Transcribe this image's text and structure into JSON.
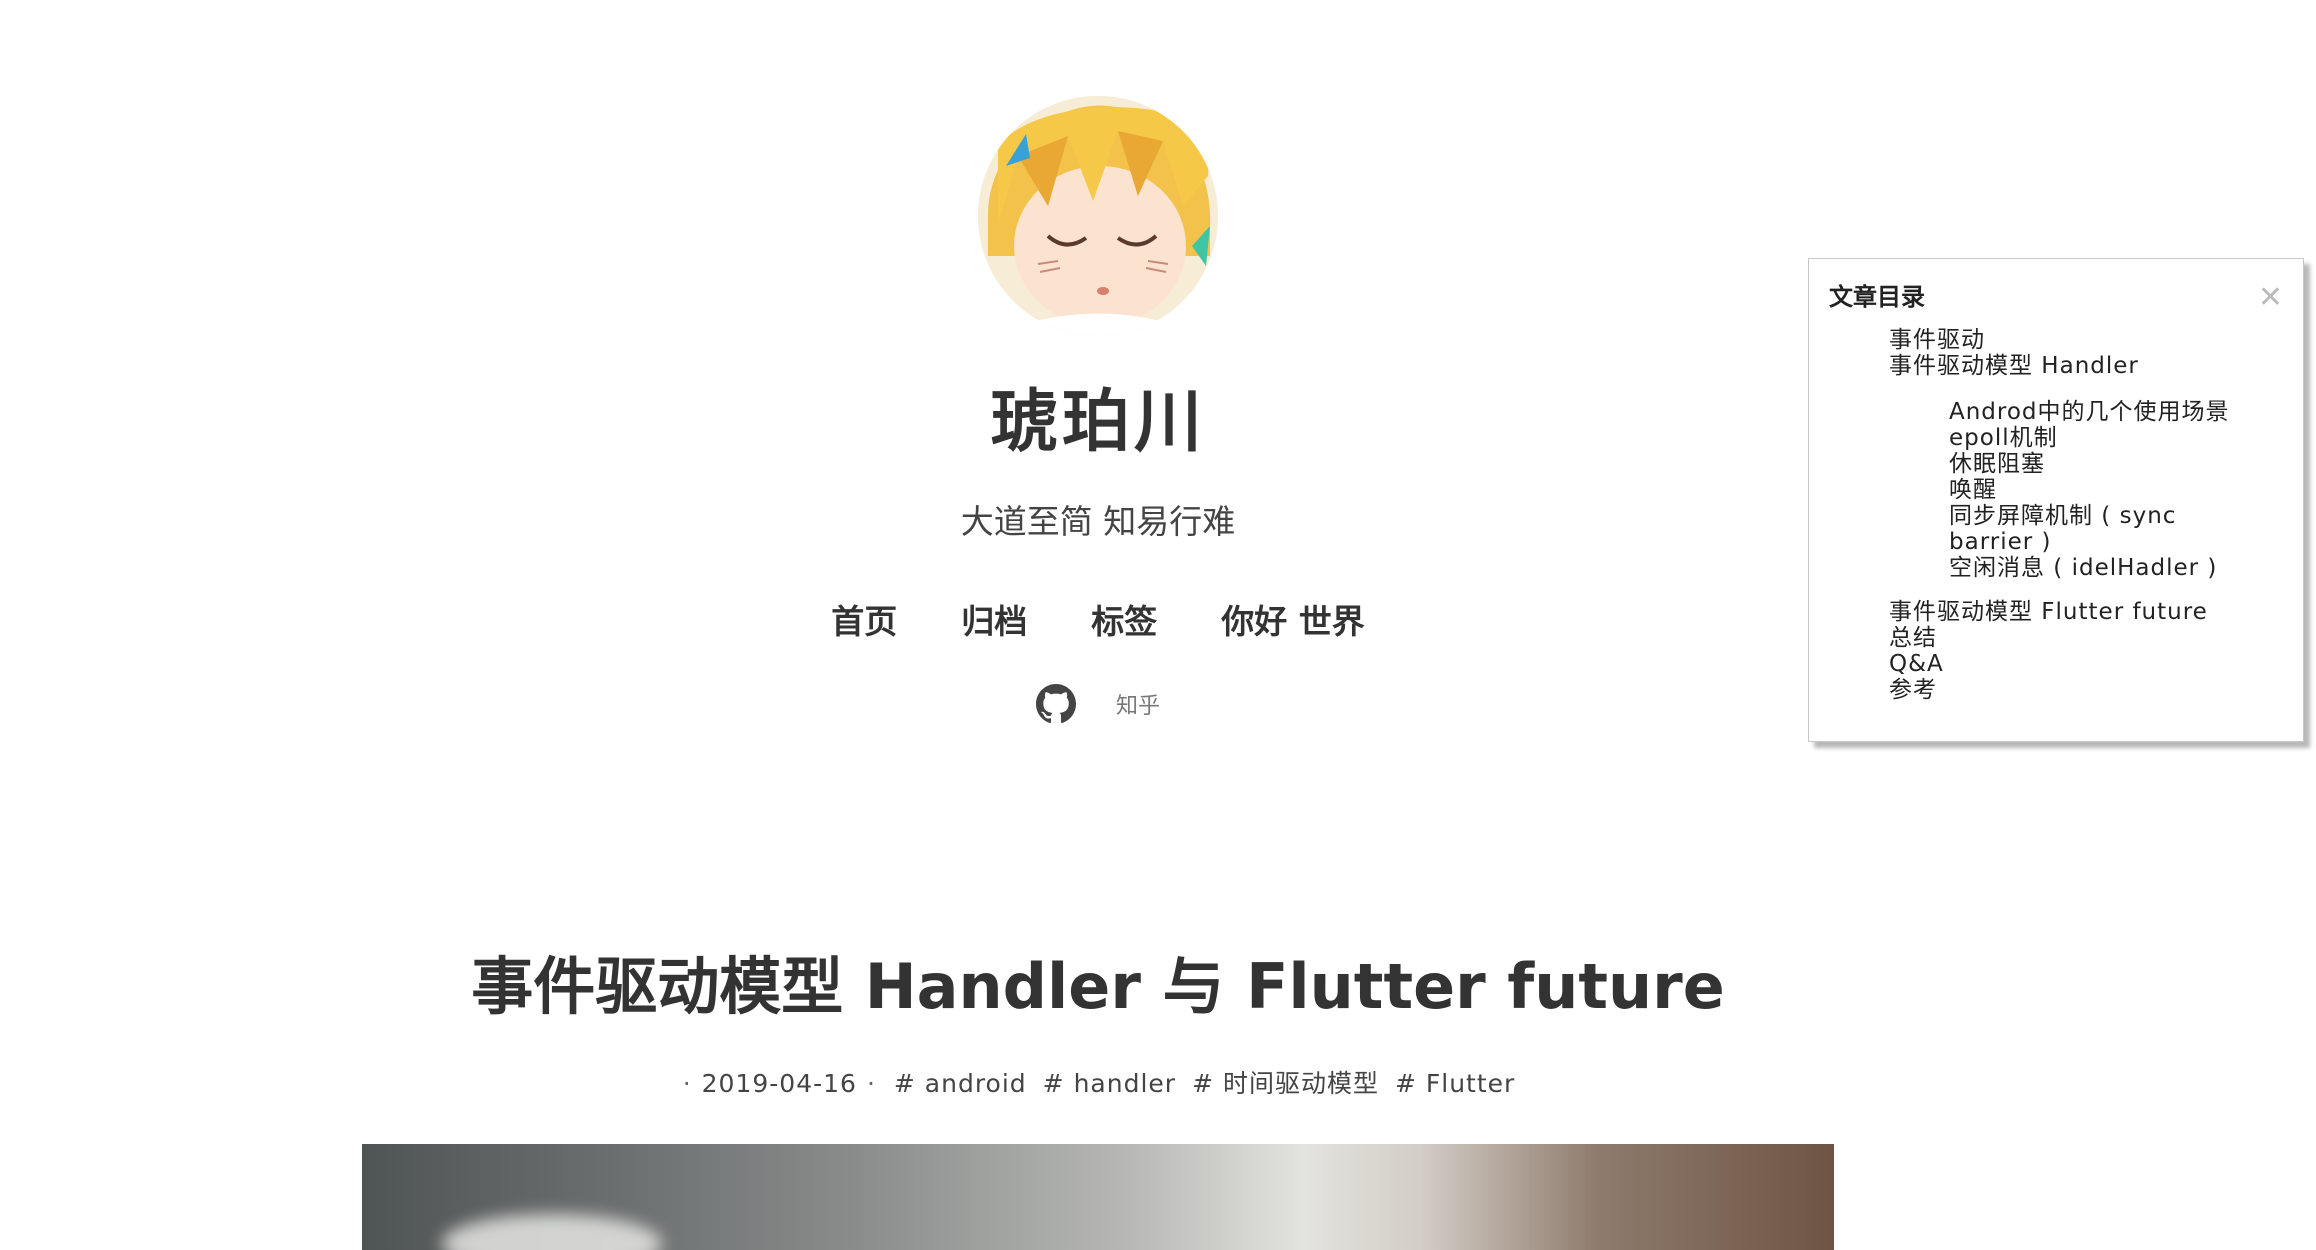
{
  "site": {
    "title": "琥珀川",
    "subtitle": "大道至简 知易行难"
  },
  "nav": {
    "items": [
      {
        "label": "首页"
      },
      {
        "label": "归档"
      },
      {
        "label": "标签"
      },
      {
        "label": "你好 世界"
      }
    ]
  },
  "social": {
    "github_icon": "github-icon",
    "zhihu_label": "知乎"
  },
  "toc": {
    "title": "文章目录",
    "close_icon": "close-icon",
    "items": [
      {
        "label": "事件驱动",
        "level": 1
      },
      {
        "label": "事件驱动模型 Handler",
        "level": 1
      },
      {
        "label": "Androd中的几个使用场景",
        "level": 2
      },
      {
        "label": "epoll机制",
        "level": 2
      },
      {
        "label": "休眠阻塞",
        "level": 2
      },
      {
        "label": "唤醒",
        "level": 2
      },
      {
        "label": "同步屏障机制 ( sync barrier )",
        "level": 2
      },
      {
        "label": "空闲消息 ( idelHadler )",
        "level": 2
      },
      {
        "label": "事件驱动模型 Flutter future",
        "level": 1
      },
      {
        "label": "总结",
        "level": 1
      },
      {
        "label": "Q&A",
        "level": 1
      },
      {
        "label": "参考",
        "level": 1
      }
    ]
  },
  "post": {
    "title": "事件驱动模型 Handler 与 Flutter future",
    "date": "2019-04-16",
    "tags": [
      "# android",
      "# handler",
      "# 时间驱动模型",
      "# Flutter"
    ]
  }
}
